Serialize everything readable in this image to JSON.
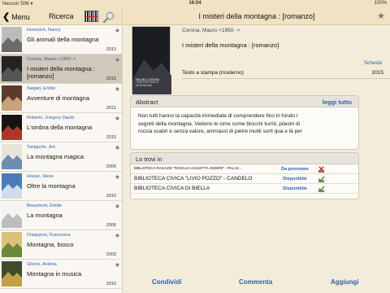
{
  "status": {
    "carrier": "Nessun SIM ▾",
    "time": "16:04",
    "battery": "100%"
  },
  "left": {
    "back_label": "Menu",
    "title": "Ricerca",
    "items": [
      {
        "author": "Honovich, Nancy",
        "title": "Gli animali della montagna",
        "year": "2013",
        "selected": false
      },
      {
        "author": "Corona, Mauro  <1950-  >",
        "title": "I misteri della montagna : [romanzo]",
        "year": "2015",
        "selected": true
      },
      {
        "author": "Salgari, Emilio",
        "title": "Avventure di montagna",
        "year": "2011",
        "selected": false
      },
      {
        "author": "Roberts, Gregory David",
        "title": "L'ombra della montagna",
        "year": "2015",
        "selected": false
      },
      {
        "author": "Taniguchi, Jirō",
        "title": "La montagna magica",
        "year": "2009",
        "selected": false
      },
      {
        "author": "House, Steve",
        "title": "Oltre la montagna",
        "year": "2010",
        "selected": false
      },
      {
        "author": "Beaumont, Émilie",
        "title": "La montagna",
        "year": "2006",
        "selected": false
      },
      {
        "author": "Chiapponi, Francesca",
        "title": "Montagna, bosco",
        "year": "2003",
        "selected": false
      },
      {
        "author": "Gherzi, Andrea",
        "title": "Montagna in musica",
        "year": "2010",
        "selected": false
      }
    ]
  },
  "detail": {
    "nav_title": "I misteri della montagna : [romanzo]",
    "cover_author": "MAURO CORONA",
    "cover_title": "I MISTERI DELLA MONTAGNA",
    "author": "Corona, Mauro  <1950-  >",
    "title": "I misteri della montagna : [romanzo]",
    "scheda_label": "Scheda",
    "type": "Testo a stampa (moderno)",
    "year": "2015",
    "abstract": {
      "label": "Abstract",
      "read_all": "leggi tutto",
      "lines": [
        "Non tutti hanno la capacità immediata di comprendere fino in fondo i",
        "segreti della montagna. Vedono le cime come blocchi turriti, pilastri di",
        "roccia scabri e senza valore, ammassi di pietre inutili sorti qua e là per"
      ]
    },
    "available": {
      "label": "Lo trovi in",
      "libraries": [
        {
          "name": "BIBLIOTECA  RAGAZZI \"ROSALIA AGLIETTA ANDERI\" - PALAZ...",
          "status": "Da prenotare",
          "icon": "unavailable-icon"
        },
        {
          "name": "BIBLIOTECA CIVICA \"LIVIO POZZO\" - CANDELO",
          "status": "Disponibile",
          "icon": "available-icon"
        },
        {
          "name": "BIBLIOTECA CIVICA DI BIELLA",
          "status": "Disponibile",
          "icon": "available-icon"
        }
      ]
    },
    "actions": {
      "share": "Condividi",
      "comment": "Commenta",
      "add": "Aggiungi"
    }
  },
  "colors": {
    "accent": "#2a5fb0",
    "nav": "#f0e2c2",
    "selected_row": "#cfc8bb"
  }
}
